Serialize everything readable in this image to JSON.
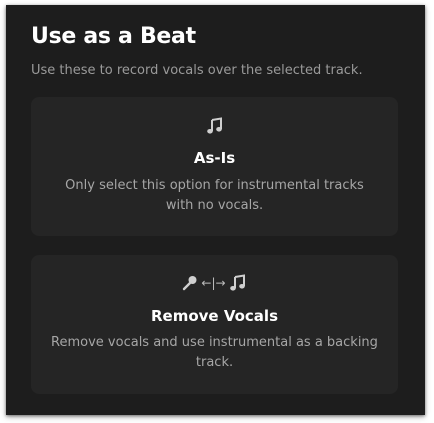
{
  "dialog": {
    "title": "Use as a Beat",
    "subtitle": "Use these to record vocals over the selected track."
  },
  "options": [
    {
      "icon": "music-note-icon",
      "title": "As-Is",
      "description": "Only select this option for instrumental tracks with no vocals."
    },
    {
      "icon": "mic-to-music-icon",
      "arrow_glyph": "←|→",
      "title": "Remove Vocals",
      "description": "Remove vocals and use instrumental as a backing track."
    }
  ],
  "colors": {
    "background": "#1d1d1d",
    "card": "#252525",
    "text_primary": "#ffffff",
    "text_secondary": "#a6a6a6"
  }
}
